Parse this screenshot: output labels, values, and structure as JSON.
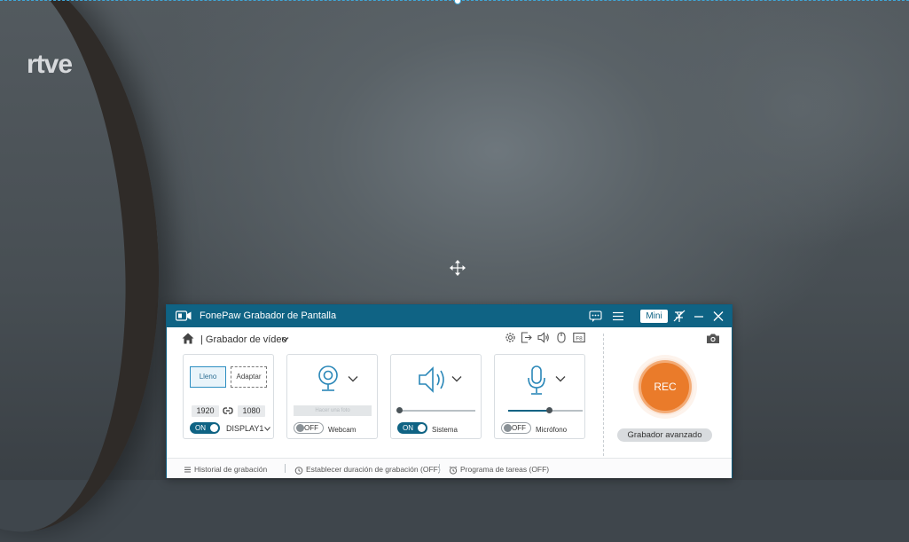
{
  "background": {
    "logo_text": "rtve"
  },
  "window": {
    "title": "FonePaw Grabador de Pantalla",
    "mini_label": "Mini",
    "icons": {
      "app": "video-camera-icon",
      "feedback": "chat-icon",
      "menu": "hamburger-menu-icon",
      "pin": "pin-icon",
      "minimize": "minimize-icon",
      "close": "close-icon"
    },
    "accent_color": "#0f6384"
  },
  "topbar": {
    "mode_label": "Grabador de vídeo",
    "separator": "|",
    "tools": [
      "settings-icon",
      "export-icon",
      "speaker-icon",
      "mouse-icon",
      "hotkey-icon"
    ],
    "screenshot_icon": "camera-icon"
  },
  "screen_panel": {
    "full_label": "Lleno",
    "fit_label": "Adaptar",
    "width": "1920",
    "height": "1080",
    "toggle": "ON",
    "display": "DISPLAY1"
  },
  "webcam_panel": {
    "disabled_button": "Hacer una foto",
    "toggle": "OFF",
    "caption": "Webcam"
  },
  "system_panel": {
    "toggle": "ON",
    "caption": "Sistema",
    "volume": 0
  },
  "mic_panel": {
    "toggle": "OFF",
    "caption": "Micrófono",
    "volume": 0.55
  },
  "record": {
    "rec_label": "REC",
    "advanced_label": "Grabador avanzado",
    "rec_color": "#ea7b2a"
  },
  "bottombar": {
    "history": "Historial de grabación",
    "duration": "Establecer duración de grabación (OFF)",
    "schedule": "Programa de tareas (OFF)"
  }
}
